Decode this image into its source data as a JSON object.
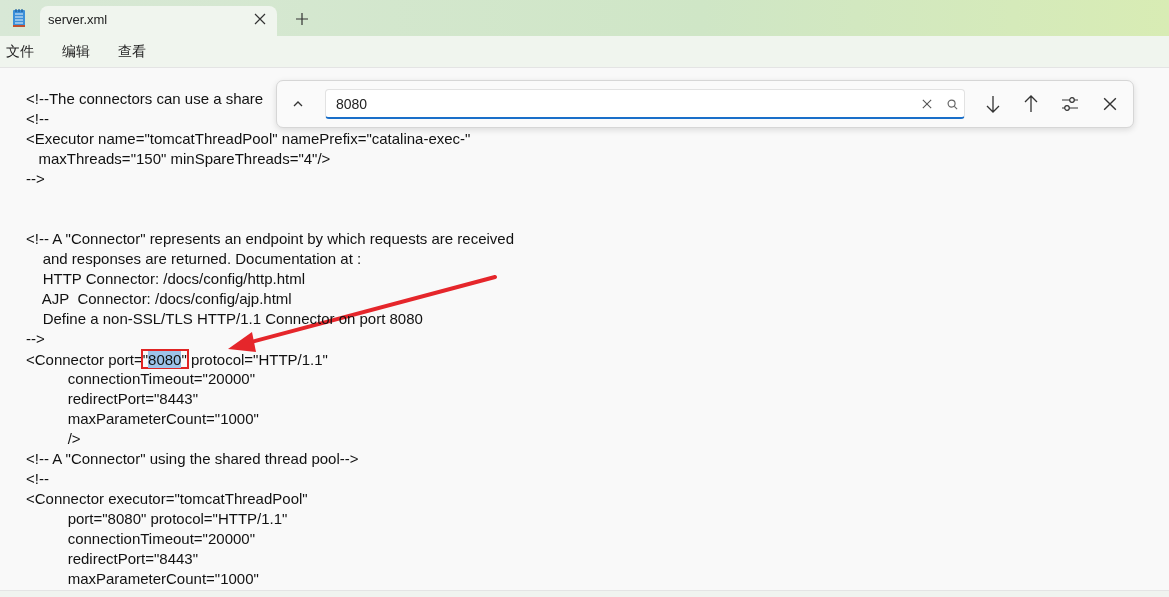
{
  "tabs": [
    {
      "label": "server.xml",
      "selected": true
    }
  ],
  "menu": [
    "文件",
    "编辑",
    "查看"
  ],
  "find_bar": {
    "value": "8080"
  },
  "editor": {
    "lines": [
      {
        "kind": "plain",
        "text": "<!--The connectors can use a share"
      },
      {
        "kind": "plain",
        "text": "<!--"
      },
      {
        "kind": "plain",
        "text": "<Executor name=\"tomcatThreadPool\" namePrefix=\"catalina-exec-\""
      },
      {
        "kind": "plain",
        "text": "   maxThreads=\"150\" minSpareThreads=\"4\"/>"
      },
      {
        "kind": "plain",
        "text": "-->"
      },
      {
        "kind": "blank"
      },
      {
        "kind": "blank"
      },
      {
        "kind": "plain",
        "text": "<!-- A \"Connector\" represents an endpoint by which requests are received"
      },
      {
        "kind": "plain",
        "text": "    and responses are returned. Documentation at :"
      },
      {
        "kind": "plain",
        "text": "    HTTP Connector: /docs/config/http.html"
      },
      {
        "kind": "plain",
        "text": "    AJP  Connector: /docs/config/ajp.html"
      },
      {
        "kind": "plain",
        "text": "    Define a non-SSL/TLS HTTP/1.1 Connector on port 8080"
      },
      {
        "kind": "plain",
        "text": "-->"
      },
      {
        "kind": "match",
        "before": "<Connector port=",
        "quote_open": "\"",
        "match": "8080",
        "quote_close": "\"",
        "after": " protocol=\"HTTP/1.1\""
      },
      {
        "kind": "plain",
        "text": "          connectionTimeout=\"20000\""
      },
      {
        "kind": "plain",
        "text": "          redirectPort=\"8443\""
      },
      {
        "kind": "plain",
        "text": "          maxParameterCount=\"1000\""
      },
      {
        "kind": "plain",
        "text": "          />"
      },
      {
        "kind": "plain",
        "text": "<!-- A \"Connector\" using the shared thread pool-->"
      },
      {
        "kind": "plain",
        "text": "<!--"
      },
      {
        "kind": "plain",
        "text": "<Connector executor=\"tomcatThreadPool\""
      },
      {
        "kind": "plain",
        "text": "          port=\"8080\" protocol=\"HTTP/1.1\""
      },
      {
        "kind": "plain",
        "text": "          connectionTimeout=\"20000\""
      },
      {
        "kind": "plain",
        "text": "          redirectPort=\"8443\""
      },
      {
        "kind": "plain",
        "text": "          maxParameterCount=\"1000\""
      }
    ]
  },
  "annotation": {
    "kind": "arrow"
  }
}
